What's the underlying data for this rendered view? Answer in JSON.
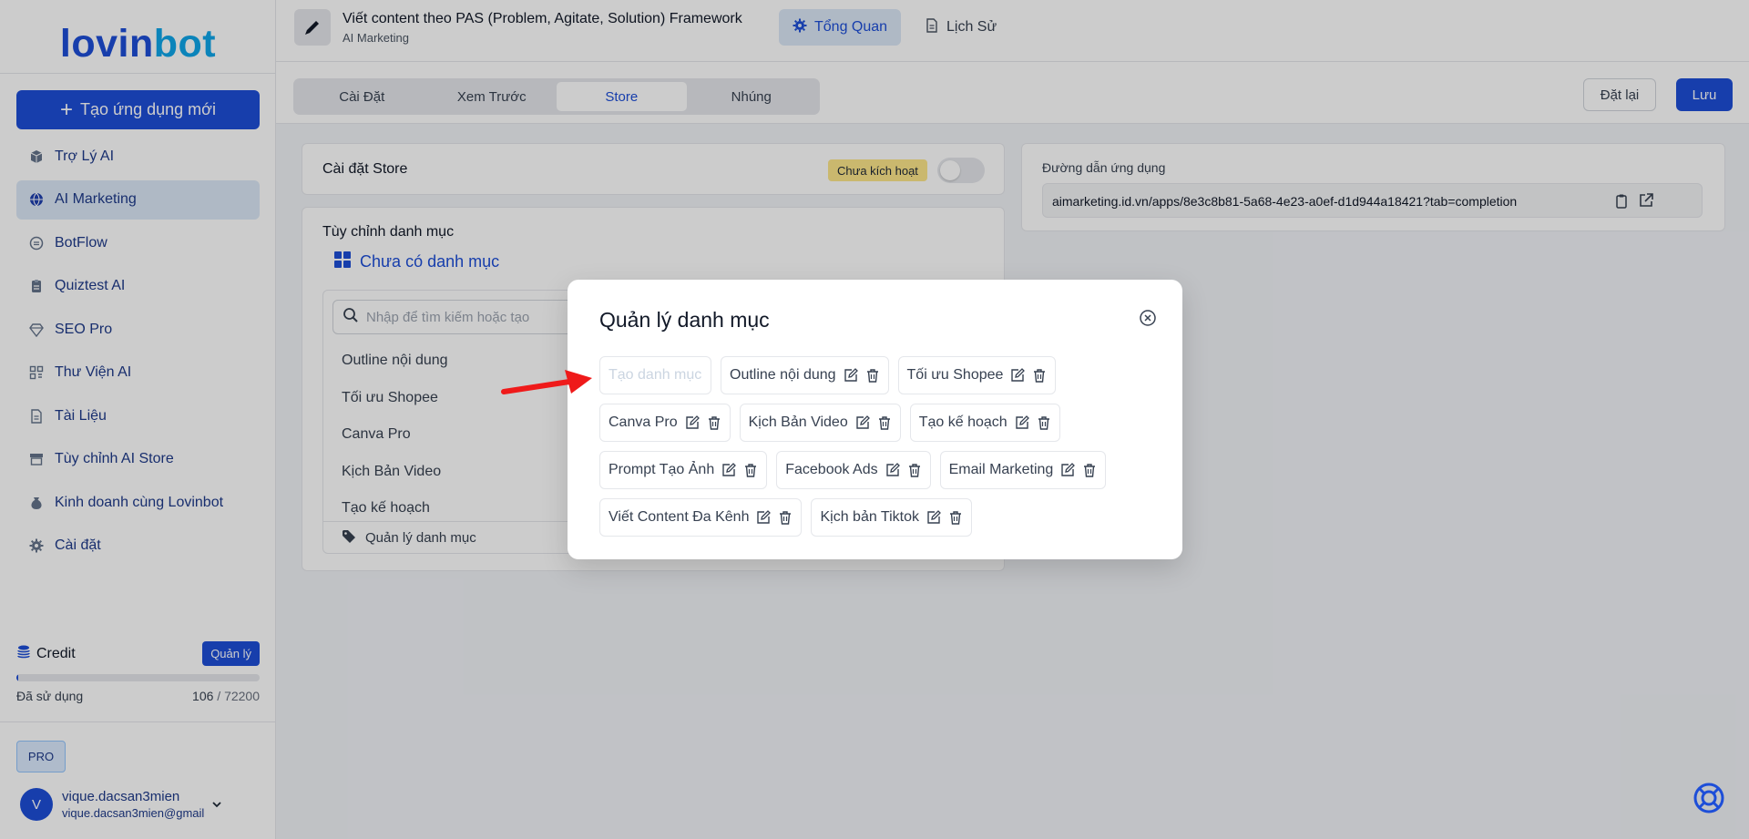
{
  "sidebar": {
    "logo_part1": "lovin",
    "logo_part2": "bot",
    "new_app_label": "Tạo ứng dụng mới",
    "items": [
      {
        "label": "Trợ Lý AI",
        "icon": "cube-icon",
        "active": false
      },
      {
        "label": "AI Marketing",
        "icon": "globe-icon",
        "active": true
      },
      {
        "label": "BotFlow",
        "icon": "circle-dash-icon",
        "active": false
      },
      {
        "label": "Quiztest AI",
        "icon": "clipboard-icon",
        "active": false
      },
      {
        "label": "SEO Pro",
        "icon": "diamond-icon",
        "active": false
      },
      {
        "label": "Thư Viện AI",
        "icon": "grid-icon",
        "active": false
      },
      {
        "label": "Tài Liệu",
        "icon": "document-icon",
        "active": false
      },
      {
        "label": "Tùy chỉnh AI Store",
        "icon": "store-icon",
        "active": false
      },
      {
        "label": "Kinh doanh cùng Lovinbot",
        "icon": "money-bag-icon",
        "active": false
      },
      {
        "label": "Cài đặt",
        "icon": "gear-icon",
        "active": false
      }
    ],
    "credit": {
      "title": "Credit",
      "manage_label": "Quản lý",
      "used_label": "Đã sử dụng",
      "used": "106",
      "separator": "/",
      "total": "72200",
      "used_fraction": 0.00147
    },
    "pro_label": "PRO",
    "user": {
      "initial": "V",
      "name": "vique.dacsan3mien",
      "email": "vique.dacsan3mien@gmail"
    }
  },
  "header": {
    "title": "Viết content theo PAS (Problem, Agitate, Solution) Framework",
    "subtitle": "AI Marketing",
    "tab_overview": "Tổng Quan",
    "tab_history": "Lịch Sử"
  },
  "subbar": {
    "tabs": [
      "Cài Đặt",
      "Xem Trước",
      "Store",
      "Nhúng"
    ],
    "active_tab": "Store",
    "reset_label": "Đặt lại",
    "save_label": "Lưu"
  },
  "store_card": {
    "title": "Cài đặt Store",
    "status": "Chưa kích hoạt"
  },
  "link_card": {
    "title": "Đường dẫn ứng dụng",
    "url": "aimarketing.id.vn/apps/8e3c8b81-5a68-4e23-a0ef-d1d944a18421?tab=completion"
  },
  "category_card": {
    "title": "Tùy chỉnh danh mục",
    "empty_label": "Chưa có danh mục",
    "search_placeholder": "Nhập để tìm kiếm hoặc tạo",
    "items": [
      "Outline nội dung",
      "Tối ưu Shopee",
      "Canva Pro",
      "Kịch Bản Video",
      "Tạo kế hoạch"
    ],
    "manage_label": "Quản lý danh mục"
  },
  "modal": {
    "title": "Quản lý danh mục",
    "input_placeholder": "Tạo danh mục",
    "chips": [
      "Outline nội dung",
      "Tối ưu Shopee",
      "Canva Pro",
      "Kịch Bản Video",
      "Tạo kế hoạch",
      "Prompt Tạo Ảnh",
      "Facebook Ads",
      "Email Marketing",
      "Viết Content Đa Kênh",
      "Kịch bản Tiktok"
    ]
  },
  "colors": {
    "primary": "#1d4ed8",
    "accent": "#0ea5e9",
    "warning_badge": "#fde68a",
    "arrow": "#ef1a1a"
  }
}
